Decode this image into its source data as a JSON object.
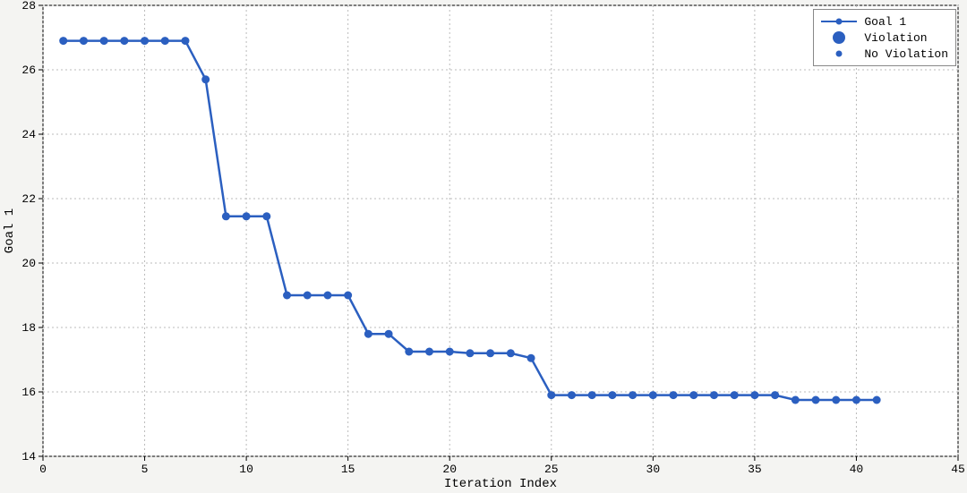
{
  "chart_data": {
    "type": "line",
    "xlabel": "Iteration Index",
    "ylabel": "Goal 1",
    "xlim": [
      0,
      45
    ],
    "ylim": [
      14,
      28
    ],
    "x_ticks": [
      0,
      5,
      10,
      15,
      20,
      25,
      30,
      35,
      40,
      45
    ],
    "y_ticks": [
      14,
      16,
      18,
      20,
      22,
      24,
      26,
      28
    ],
    "legend": {
      "position": "top-right",
      "entries": [
        "Goal 1",
        "Violation",
        "No Violation"
      ]
    },
    "series": [
      {
        "name": "Goal 1",
        "x": [
          1,
          2,
          3,
          4,
          5,
          6,
          7,
          8,
          9,
          10,
          11,
          12,
          13,
          14,
          15,
          16,
          17,
          18,
          19,
          20,
          21,
          22,
          23,
          24,
          25,
          26,
          27,
          28,
          29,
          30,
          31,
          32,
          33,
          34,
          35,
          36,
          37,
          38,
          39,
          40,
          41
        ],
        "y": [
          26.9,
          26.9,
          26.9,
          26.9,
          26.9,
          26.9,
          26.9,
          25.7,
          21.45,
          21.45,
          21.45,
          19.0,
          19.0,
          19.0,
          19.0,
          17.8,
          17.8,
          17.25,
          17.25,
          17.25,
          17.2,
          17.2,
          17.2,
          17.05,
          15.9,
          15.9,
          15.9,
          15.9,
          15.9,
          15.9,
          15.9,
          15.9,
          15.9,
          15.9,
          15.9,
          15.9,
          15.75,
          15.75,
          15.75,
          15.75,
          15.75
        ],
        "violation": [
          false,
          false,
          false,
          false,
          false,
          false,
          false,
          false,
          false,
          false,
          false,
          false,
          false,
          false,
          false,
          false,
          false,
          false,
          false,
          false,
          false,
          false,
          false,
          false,
          false,
          false,
          false,
          false,
          false,
          false,
          false,
          false,
          false,
          false,
          false,
          false,
          false,
          false,
          false,
          false,
          false
        ]
      }
    ],
    "colors": {
      "line": "#2b5fc0",
      "marker": "#2b5fc0",
      "grid": "#bbbbbb",
      "plot_bg": "#ffffff",
      "outer_bg": "#f4f4f2",
      "axis": "#000000"
    }
  }
}
